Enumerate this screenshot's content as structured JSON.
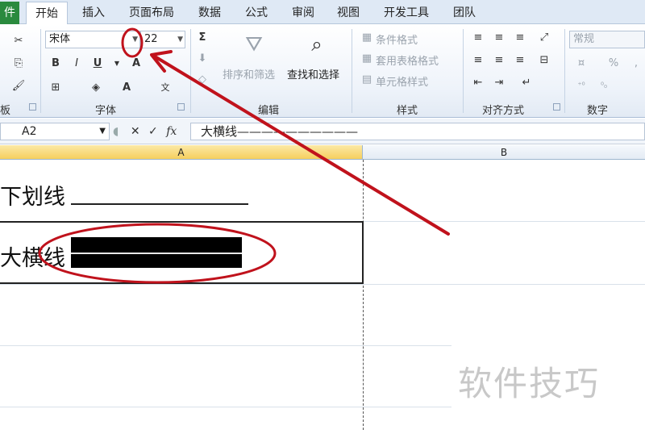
{
  "tabs": {
    "file": "件",
    "items": [
      "开始",
      "插入",
      "页面布局",
      "数据",
      "公式",
      "审阅",
      "视图",
      "开发工具",
      "团队"
    ],
    "active": "开始"
  },
  "ribbon": {
    "clipboard_label": "板",
    "font": {
      "name": "宋体",
      "size": "22",
      "bold": "B",
      "italic": "I",
      "underline": "U",
      "grow": "A",
      "color_a": "A",
      "wen": "文",
      "label": "字体"
    },
    "editing": {
      "sigma": "Σ",
      "sort_filter": "排序和筛选",
      "find_select": "查找和选择",
      "label": "编辑"
    },
    "styles": {
      "conditional": "条件格式",
      "table_format": "套用表格格式",
      "cell_styles": "单元格样式",
      "label": "样式"
    },
    "alignment": {
      "label": "对齐方式"
    },
    "number": {
      "format": "常规",
      "percent": "%",
      "comma": ",",
      "label": "数字"
    }
  },
  "formula_bar": {
    "name_box": "A2",
    "cancel": "✕",
    "enter": "✓",
    "fx": "fx",
    "content": "大横线——————————"
  },
  "columns": [
    "A",
    "B"
  ],
  "cells": {
    "a1": "下划线",
    "a2": "大横线"
  },
  "watermark": "软件技巧",
  "colors": {
    "annotation": "#c0121c",
    "file_tab": "#2a8a3e",
    "selected_col": "#f6cf5e"
  }
}
